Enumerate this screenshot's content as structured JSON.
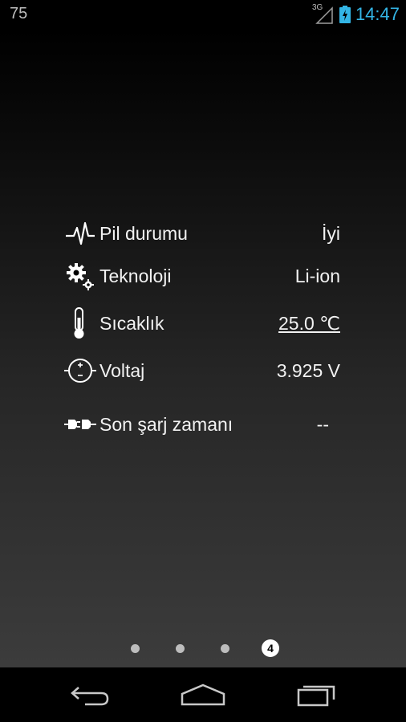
{
  "status": {
    "left_text": "75",
    "network": "3G",
    "time": "14:47",
    "time_color": "#33b5e5"
  },
  "battery_info": {
    "rows": [
      {
        "icon": "heartbeat-icon",
        "label": "Pil durumu",
        "value": "İyi"
      },
      {
        "icon": "gears-icon",
        "label": "Teknoloji",
        "value": "Li-ion"
      },
      {
        "icon": "thermometer-icon",
        "label": "Sıcaklık",
        "value": "25.0 ℃"
      },
      {
        "icon": "voltage-icon",
        "label": "Voltaj",
        "value": "3.925 V"
      },
      {
        "icon": "plug-icon",
        "label": "Son şarj zamanı",
        "value": "--"
      }
    ]
  },
  "pager": {
    "active_label": "4"
  },
  "nav": {
    "buttons": [
      "back-icon",
      "home-icon",
      "recents-icon"
    ]
  }
}
